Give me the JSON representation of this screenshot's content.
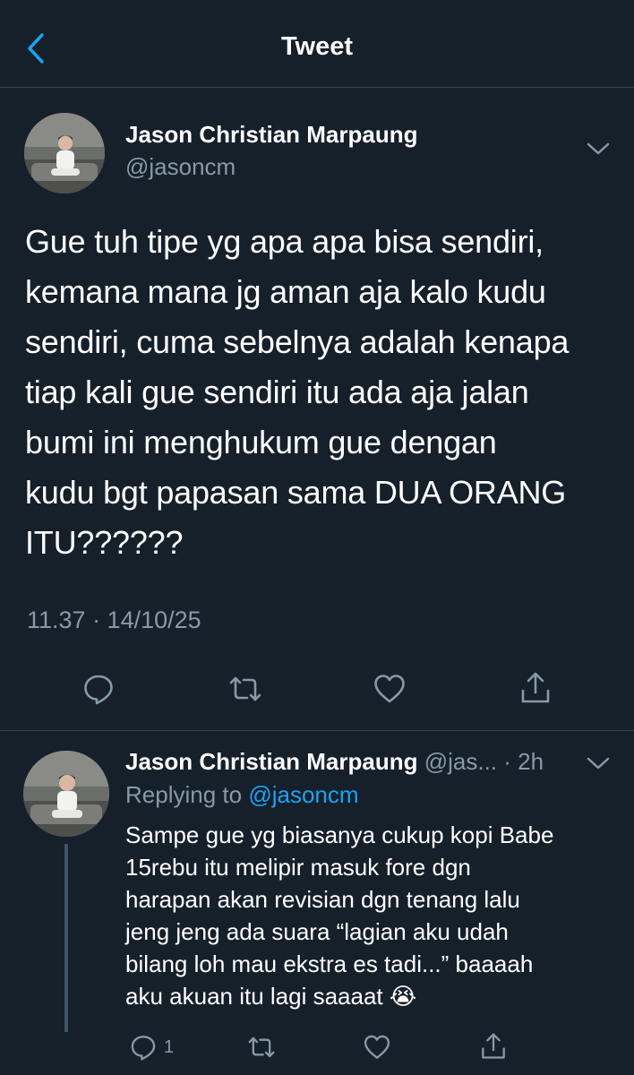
{
  "header": {
    "title": "Tweet",
    "back_icon": "chevron-left-icon",
    "accent": "#1da1f2"
  },
  "tweet": {
    "author_name": "Jason Christian Marpaung",
    "author_handle": "@jasoncm",
    "text": "Gue tuh tipe yg apa apa bisa sendiri,\nkemana mana jg aman aja kalo kudu\nsendiri, cuma sebelnya adalah kenapa\ntiap kali gue sendiri itu ada aja jalan\nbumi ini menghukum gue dengan\nkudu bgt papasan sama DUA ORANG\nITU??????",
    "timestamp": "11.37 · 14/10/25",
    "actions": {
      "reply_icon": "reply-icon",
      "retweet_icon": "retweet-icon",
      "like_icon": "heart-icon",
      "share_icon": "share-icon"
    }
  },
  "reply": {
    "author_name": "Jason Christian Marpaung",
    "author_handle": "@jas...",
    "time": "· 2h",
    "replying_prefix": "Replying to",
    "replying_to": "@jasoncm",
    "text": "Sampe gue yg biasanya cukup kopi Babe\n15rebu itu melipir masuk fore dgn\nharapan akan revisian dgn tenang lalu\njeng jeng ada suara “lagian aku udah\nbilang loh mau ekstra es tadi...” baaaah\naku akuan itu lagi saaaat 😭",
    "reply_count": "1"
  },
  "colors": {
    "background": "#15202b",
    "secondary_text": "#8899a6",
    "divider": "#38444d"
  }
}
